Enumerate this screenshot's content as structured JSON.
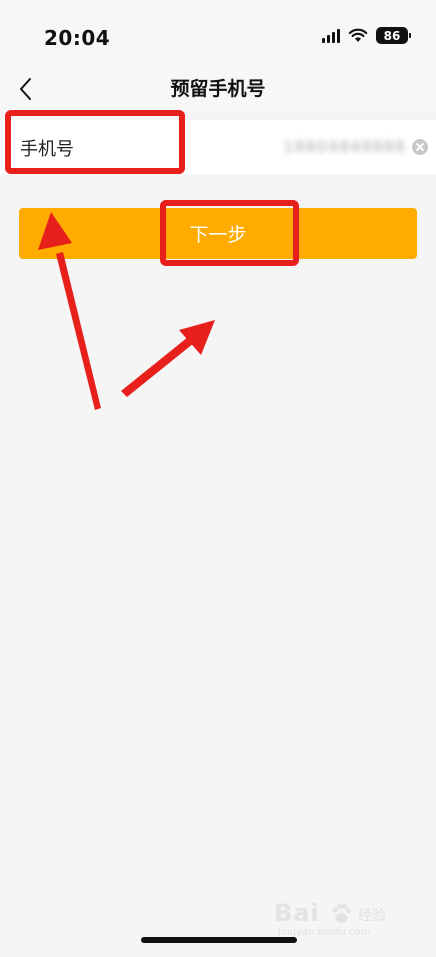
{
  "status_bar": {
    "time": "20:04",
    "battery": "86",
    "icons": [
      "signal-icon",
      "wifi-icon",
      "battery-icon"
    ]
  },
  "nav": {
    "title": "预留手机号",
    "back_icon": "chevron-left-icon"
  },
  "form": {
    "phone_label": "手机号",
    "phone_value": "18804848888",
    "clear_icon": "clear-circle-icon"
  },
  "actions": {
    "next_label": "下一步"
  },
  "annotations": {
    "color": "#e8201c",
    "highlights": [
      "phone-label-box",
      "next-button-box"
    ],
    "arrows": 2
  },
  "watermark": {
    "brand": "Bai",
    "sub": "经验",
    "url": "jingyan.baidu.com"
  },
  "colors": {
    "accent": "#ffab00",
    "background": "#f5f5f5",
    "annotation": "#e8201c"
  }
}
